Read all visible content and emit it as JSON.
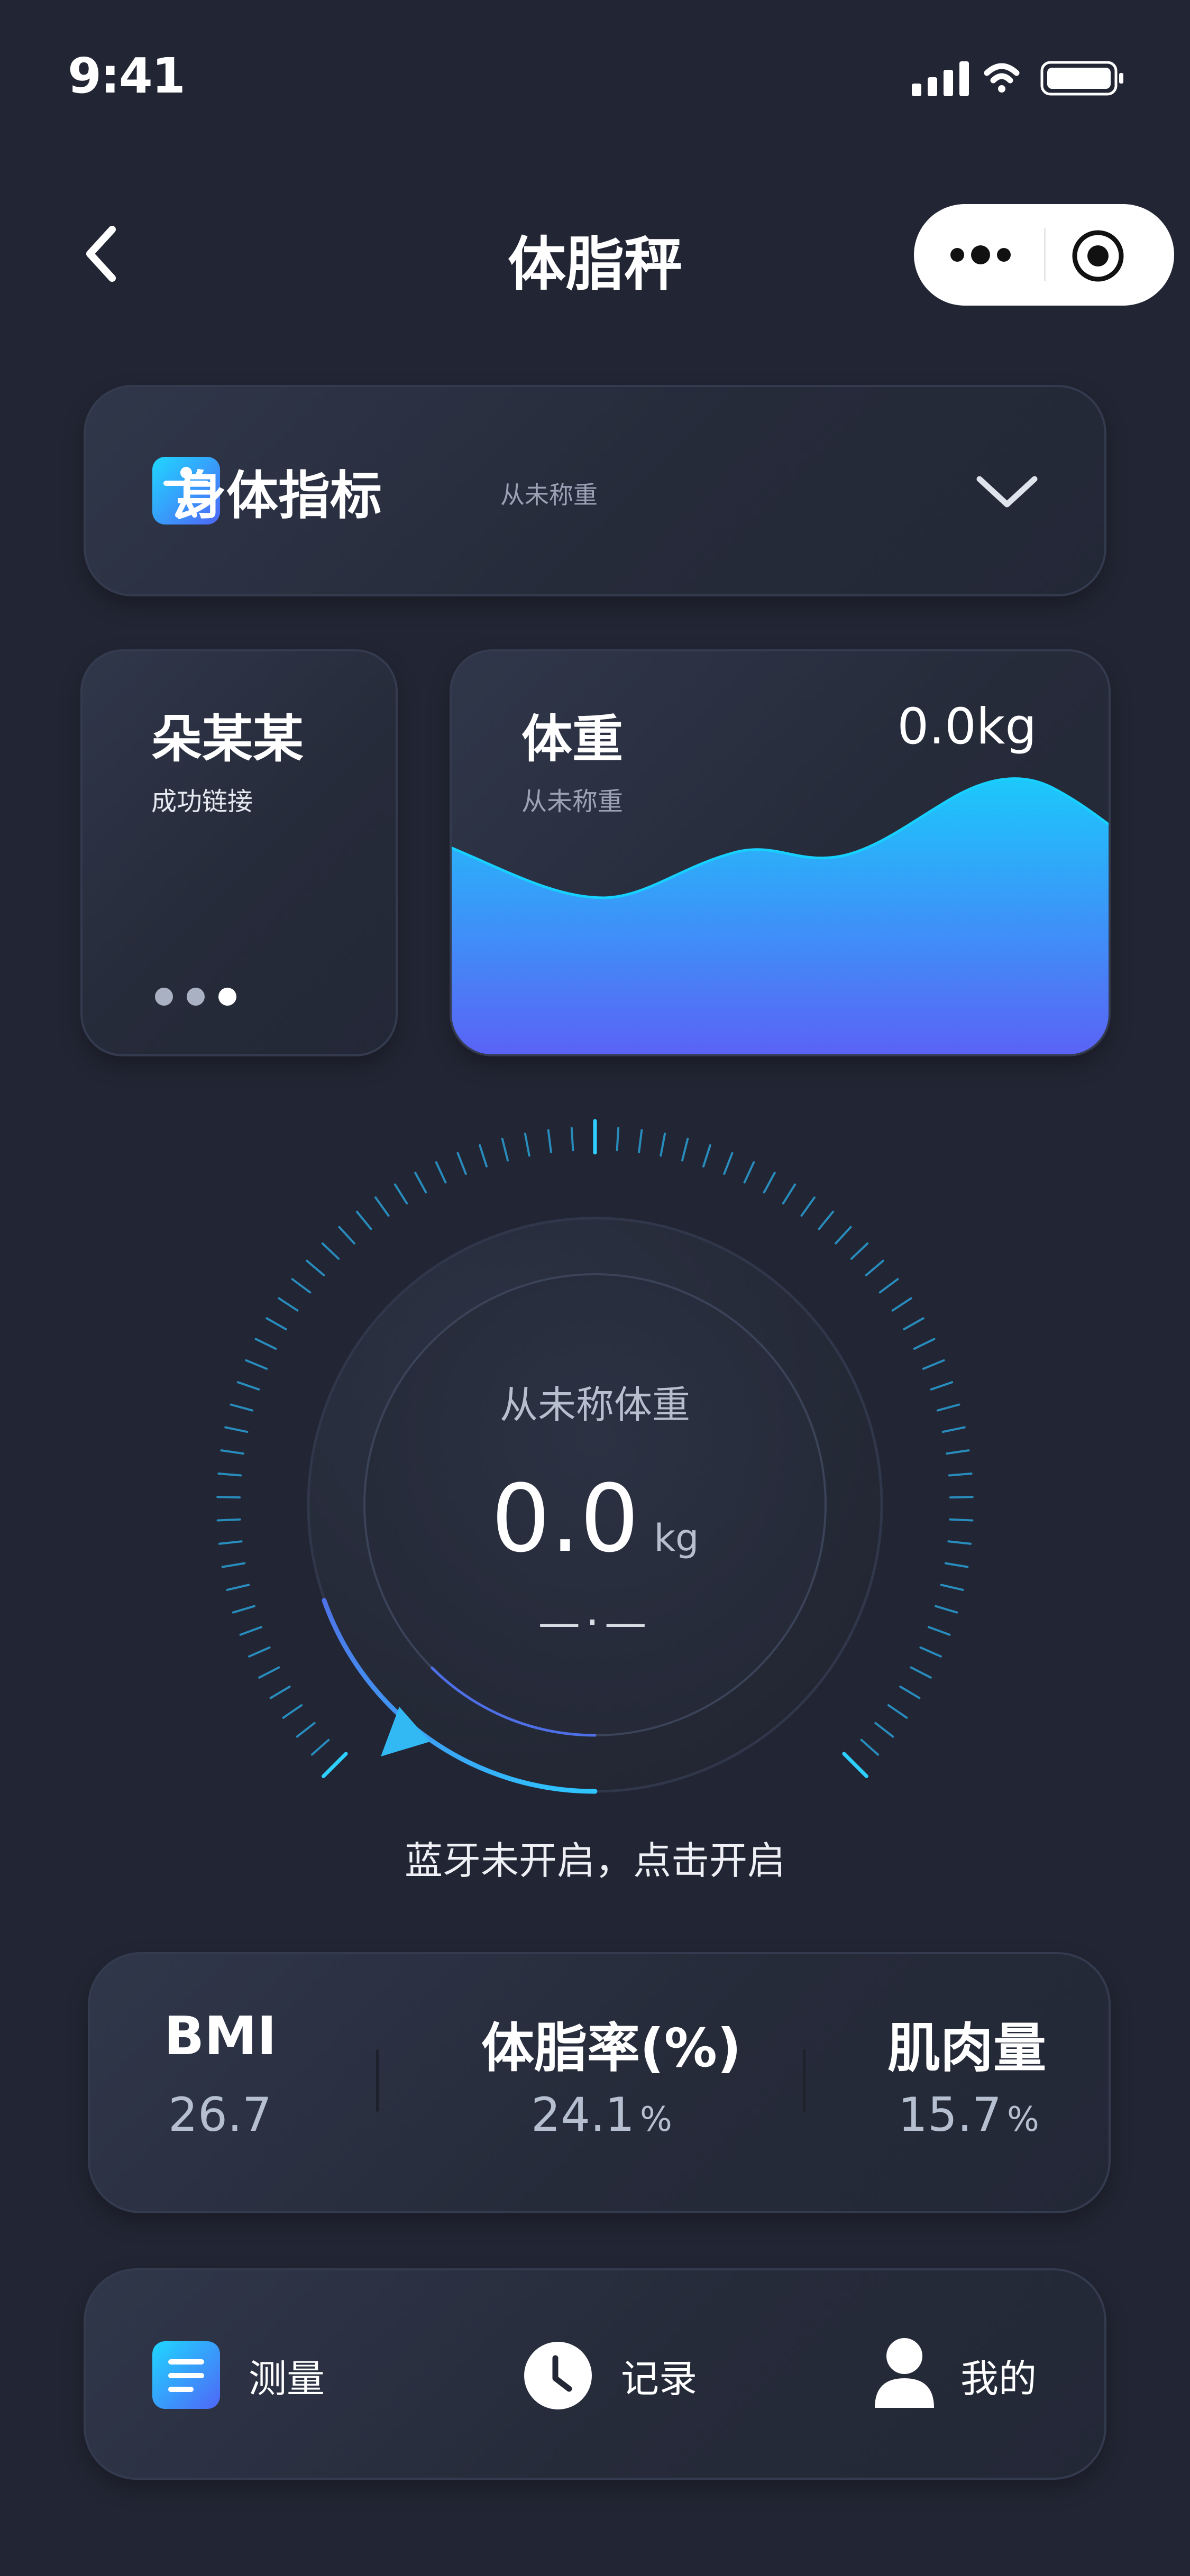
{
  "status_bar": {
    "time": "9:41"
  },
  "nav": {
    "title": "体脂秤"
  },
  "indicator": {
    "title": "身体指标",
    "subtitle": "从未称重"
  },
  "user": {
    "name": "朵某某",
    "status": "成功链接"
  },
  "weight": {
    "label": "体重",
    "subtitle": "从未称重",
    "value": "0.0kg"
  },
  "gauge": {
    "label": "从未称体重",
    "value": "0.0",
    "unit": "kg",
    "dash": "—·—"
  },
  "bluetooth_hint": "蓝牙未开启，点击开启",
  "stats": [
    {
      "label": "BMI",
      "value": "26.7",
      "unit": ""
    },
    {
      "label": "体脂率(%)",
      "value": "24.1",
      "unit": "%"
    },
    {
      "label": "肌肉量",
      "value": "15.7",
      "unit": "%"
    }
  ],
  "bottom_nav": [
    {
      "label": "测量",
      "icon": "list-icon"
    },
    {
      "label": "记录",
      "icon": "clock-icon"
    },
    {
      "label": "我的",
      "icon": "user-icon"
    }
  ],
  "colors": {
    "background": "#222533",
    "accent_cyan": "#18d0ff",
    "accent_blue": "#5a63f5"
  }
}
